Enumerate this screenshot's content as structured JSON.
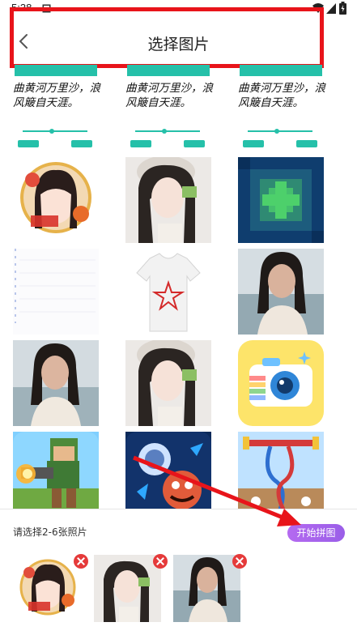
{
  "status_bar": {
    "time": "5:38"
  },
  "app_bar": {
    "title": "选择图片",
    "back_icon": "chevron-left-icon"
  },
  "promo_cards": [
    {
      "verse_line1": "曲黄河万里沙，浪",
      "verse_line2": "风簸自天涯。"
    },
    {
      "verse_line1": "曲黄河万里沙，浪",
      "verse_line2": "风簸自天涯。"
    },
    {
      "verse_line1": "曲黄河万里沙，浪",
      "verse_line2": "风簸自天涯。"
    }
  ],
  "bottom": {
    "hint": "请选择2-6张照片",
    "start_button": "开始拼图"
  },
  "colors": {
    "accent_teal": "#25c0a9",
    "start_button": "#a463ec",
    "delete_badge": "#e53a3a",
    "annotation_red": "#e8141a"
  }
}
